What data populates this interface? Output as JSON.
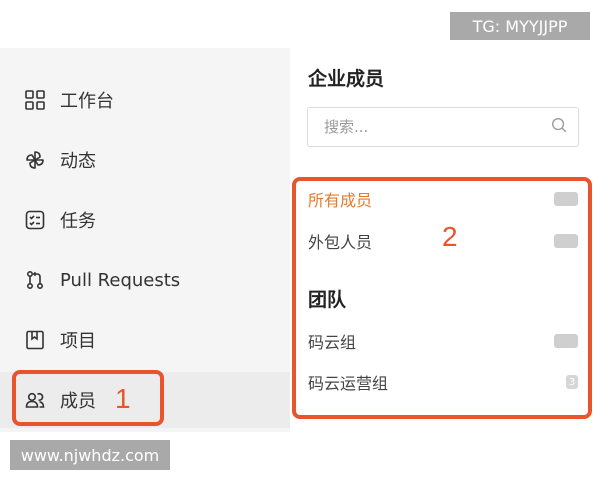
{
  "watermarks": {
    "top": "TG: MYYJJPP",
    "bottom": "www.njwhdz.com"
  },
  "sidebar": {
    "items": [
      {
        "label": "工作台",
        "icon": "dashboard-icon"
      },
      {
        "label": "动态",
        "icon": "pinwheel-icon"
      },
      {
        "label": "任务",
        "icon": "task-list-icon"
      },
      {
        "label": "Pull Requests",
        "icon": "pull-request-icon"
      },
      {
        "label": "项目",
        "icon": "book-icon"
      },
      {
        "label": "成员",
        "icon": "members-icon",
        "active": true
      }
    ]
  },
  "main": {
    "title": "企业成员",
    "search": {
      "placeholder": "搜索...",
      "value": ""
    },
    "members": [
      {
        "label": "所有成员",
        "count": "",
        "active": true
      },
      {
        "label": "外包人员",
        "count": ""
      }
    ],
    "teams_title": "团队",
    "teams": [
      {
        "label": "码云组",
        "count": ""
      },
      {
        "label": "码云运营组",
        "count": "3"
      }
    ]
  },
  "annotations": {
    "box1_number": "1",
    "box2_number": "2",
    "color": "#e8542c"
  },
  "colors": {
    "accent": "#e37b2e",
    "sidebar_bg": "#f5f5f5"
  }
}
